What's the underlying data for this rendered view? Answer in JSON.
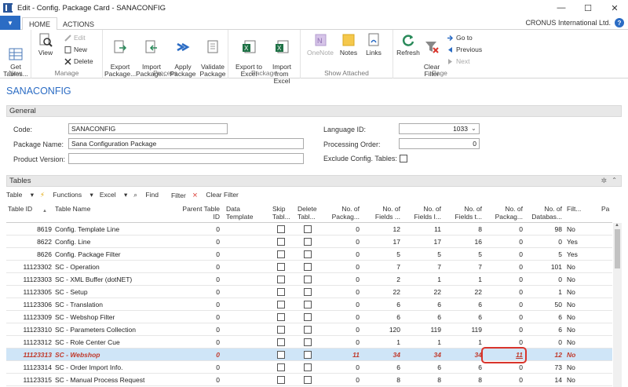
{
  "window": {
    "title": "Edit - Config. Package Card - SANACONFIG",
    "controls": [
      "—",
      "☐",
      "✕"
    ]
  },
  "ribbon": {
    "file_tab": "▼",
    "tabs": [
      "HOME",
      "ACTIONS"
    ],
    "company": "CRONUS International Ltd.",
    "help": "?",
    "groups": {
      "new": {
        "label": "New",
        "get_tables": "Get\nTables..."
      },
      "manage": {
        "label": "Manage",
        "view": "View",
        "edit": "Edit",
        "new": "New",
        "delete": "Delete"
      },
      "process": {
        "label": "Process",
        "export_package": "Export\nPackage...",
        "import_package": "Import\nPackage...",
        "apply_package": "Apply\nPackage",
        "validate_package": "Validate\nPackage"
      },
      "package": {
        "label": "Package",
        "export_excel": "Export to\nExcel",
        "import_excel": "Import\nfrom Excel"
      },
      "show_attached": {
        "label": "Show Attached",
        "onenote": "OneNote",
        "notes": "Notes",
        "links": "Links"
      },
      "page": {
        "label": "Page",
        "refresh": "Refresh",
        "clear_filter": "Clear\nFilter",
        "goto": "Go to",
        "previous": "Previous",
        "next": "Next"
      }
    }
  },
  "page_title": "SANACONFIG",
  "general": {
    "header": "General",
    "code_label": "Code:",
    "code_value": "SANACONFIG",
    "package_name_label": "Package Name:",
    "package_name_value": "Sana Configuration Package",
    "product_version_label": "Product Version:",
    "product_version_value": "",
    "language_id_label": "Language ID:",
    "language_id_value": "1033",
    "processing_order_label": "Processing Order:",
    "processing_order_value": "0",
    "exclude_tables_label": "Exclude Config. Tables:",
    "exclude_tables_checked": false
  },
  "tables": {
    "header": "Tables",
    "toolbar": {
      "table": "Table",
      "functions": "Functions",
      "excel": "Excel",
      "find": "Find",
      "filter": "Filter",
      "clear_filter": "Clear Filter"
    },
    "columns": [
      "Table ID",
      "Table Name",
      "Parent Table\nID",
      "Data\nTemplate",
      "Skip\nTabl...",
      "Delete\nTabl...",
      "No. of\nPackag...",
      "No. of\nFields ...",
      "No. of\nFields I...",
      "No. of\nFields t...",
      "No. of\nPackag...",
      "No. of\nDatabas...",
      "Filt...",
      "Pa"
    ],
    "rows": [
      {
        "id": "8619",
        "name": "Config. Template Line",
        "parent": "0",
        "pkg": "0",
        "fields_a": "12",
        "fields_i": "11",
        "fields_t": "8",
        "pkg2": "0",
        "db": "98",
        "filt": "No"
      },
      {
        "id": "8622",
        "name": "Config. Line",
        "parent": "0",
        "pkg": "0",
        "fields_a": "17",
        "fields_i": "17",
        "fields_t": "16",
        "pkg2": "0",
        "db": "0",
        "filt": "Yes"
      },
      {
        "id": "8626",
        "name": "Config. Package Filter",
        "parent": "0",
        "pkg": "0",
        "fields_a": "5",
        "fields_i": "5",
        "fields_t": "5",
        "pkg2": "0",
        "db": "5",
        "filt": "Yes"
      },
      {
        "id": "11123302",
        "name": "SC - Operation",
        "parent": "0",
        "pkg": "0",
        "fields_a": "7",
        "fields_i": "7",
        "fields_t": "7",
        "pkg2": "0",
        "db": "101",
        "filt": "No"
      },
      {
        "id": "11123303",
        "name": "SC - XML Buffer (dotNET)",
        "parent": "0",
        "pkg": "0",
        "fields_a": "2",
        "fields_i": "1",
        "fields_t": "1",
        "pkg2": "0",
        "db": "0",
        "filt": "No"
      },
      {
        "id": "11123305",
        "name": "SC - Setup",
        "parent": "0",
        "pkg": "0",
        "fields_a": "22",
        "fields_i": "22",
        "fields_t": "22",
        "pkg2": "0",
        "db": "1",
        "filt": "No"
      },
      {
        "id": "11123306",
        "name": "SC - Translation",
        "parent": "0",
        "pkg": "0",
        "fields_a": "6",
        "fields_i": "6",
        "fields_t": "6",
        "pkg2": "0",
        "db": "50",
        "filt": "No"
      },
      {
        "id": "11123309",
        "name": "SC - Webshop Filter",
        "parent": "0",
        "pkg": "0",
        "fields_a": "6",
        "fields_i": "6",
        "fields_t": "6",
        "pkg2": "0",
        "db": "6",
        "filt": "No"
      },
      {
        "id": "11123310",
        "name": "SC - Parameters Collection",
        "parent": "0",
        "pkg": "0",
        "fields_a": "120",
        "fields_i": "119",
        "fields_t": "119",
        "pkg2": "0",
        "db": "6",
        "filt": "No"
      },
      {
        "id": "11123312",
        "name": "SC - Role Center Cue",
        "parent": "0",
        "pkg": "0",
        "fields_a": "1",
        "fields_i": "1",
        "fields_t": "1",
        "pkg2": "0",
        "db": "0",
        "filt": "No"
      },
      {
        "id": "11123313",
        "name": "SC - Webshop",
        "parent": "0",
        "pkg": "11",
        "fields_a": "34",
        "fields_i": "34",
        "fields_t": "34",
        "pkg2": "11",
        "db": "12",
        "filt": "No"
      },
      {
        "id": "11123314",
        "name": "SC - Order Import Info.",
        "parent": "0",
        "pkg": "0",
        "fields_a": "6",
        "fields_i": "6",
        "fields_t": "6",
        "pkg2": "0",
        "db": "73",
        "filt": "No"
      },
      {
        "id": "11123315",
        "name": "SC - Manual Process Request",
        "parent": "0",
        "pkg": "0",
        "fields_a": "8",
        "fields_i": "8",
        "fields_t": "8",
        "pkg2": "0",
        "db": "14",
        "filt": "No"
      }
    ],
    "selected_row": 10
  },
  "colors": {
    "accent": "#2b6cc4",
    "selected_row": "#cfe5f7",
    "selected_text": "#c0392b",
    "callout": "#d9342b"
  }
}
